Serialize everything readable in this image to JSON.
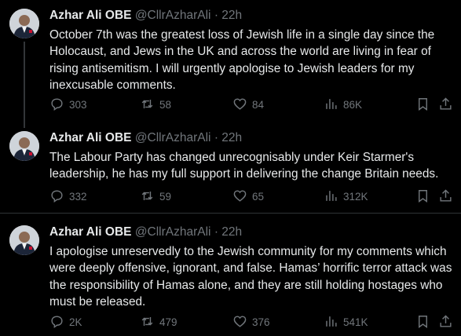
{
  "tweets": [
    {
      "name": "Azhar Ali OBE",
      "handle": "@CllrAzharAli",
      "time": "· 22h",
      "text": "October 7th was the greatest loss of Jewish life in a single day since the Holocaust, and Jews in the UK and across the world are living in fear of rising antisemitism. I will urgently apologise to Jewish leaders for my inexcusable comments.",
      "replies": "303",
      "reposts": "58",
      "likes": "84",
      "views": "86K"
    },
    {
      "name": "Azhar Ali OBE",
      "handle": "@CllrAzharAli",
      "time": "· 22h",
      "text": "The Labour Party has changed unrecognisably under Keir Starmer's leadership, he has my full support in delivering the change Britain needs.",
      "replies": "332",
      "reposts": "59",
      "likes": "65",
      "views": "312K"
    },
    {
      "name": "Azhar Ali OBE",
      "handle": "@CllrAzharAli",
      "time": "· 22h",
      "text": "I apologise unreservedly to the Jewish community for my comments which were deeply offensive, ignorant, and false. Hamas’ horrific terror attack was the responsibility of Hamas alone, and they are still holding hostages who must be released.",
      "replies": "2K",
      "reposts": "479",
      "likes": "376",
      "views": "541K"
    }
  ],
  "colors": {
    "background": "#000000",
    "text": "#e7e9ea",
    "muted": "#71767b",
    "divider": "#2f3336"
  }
}
